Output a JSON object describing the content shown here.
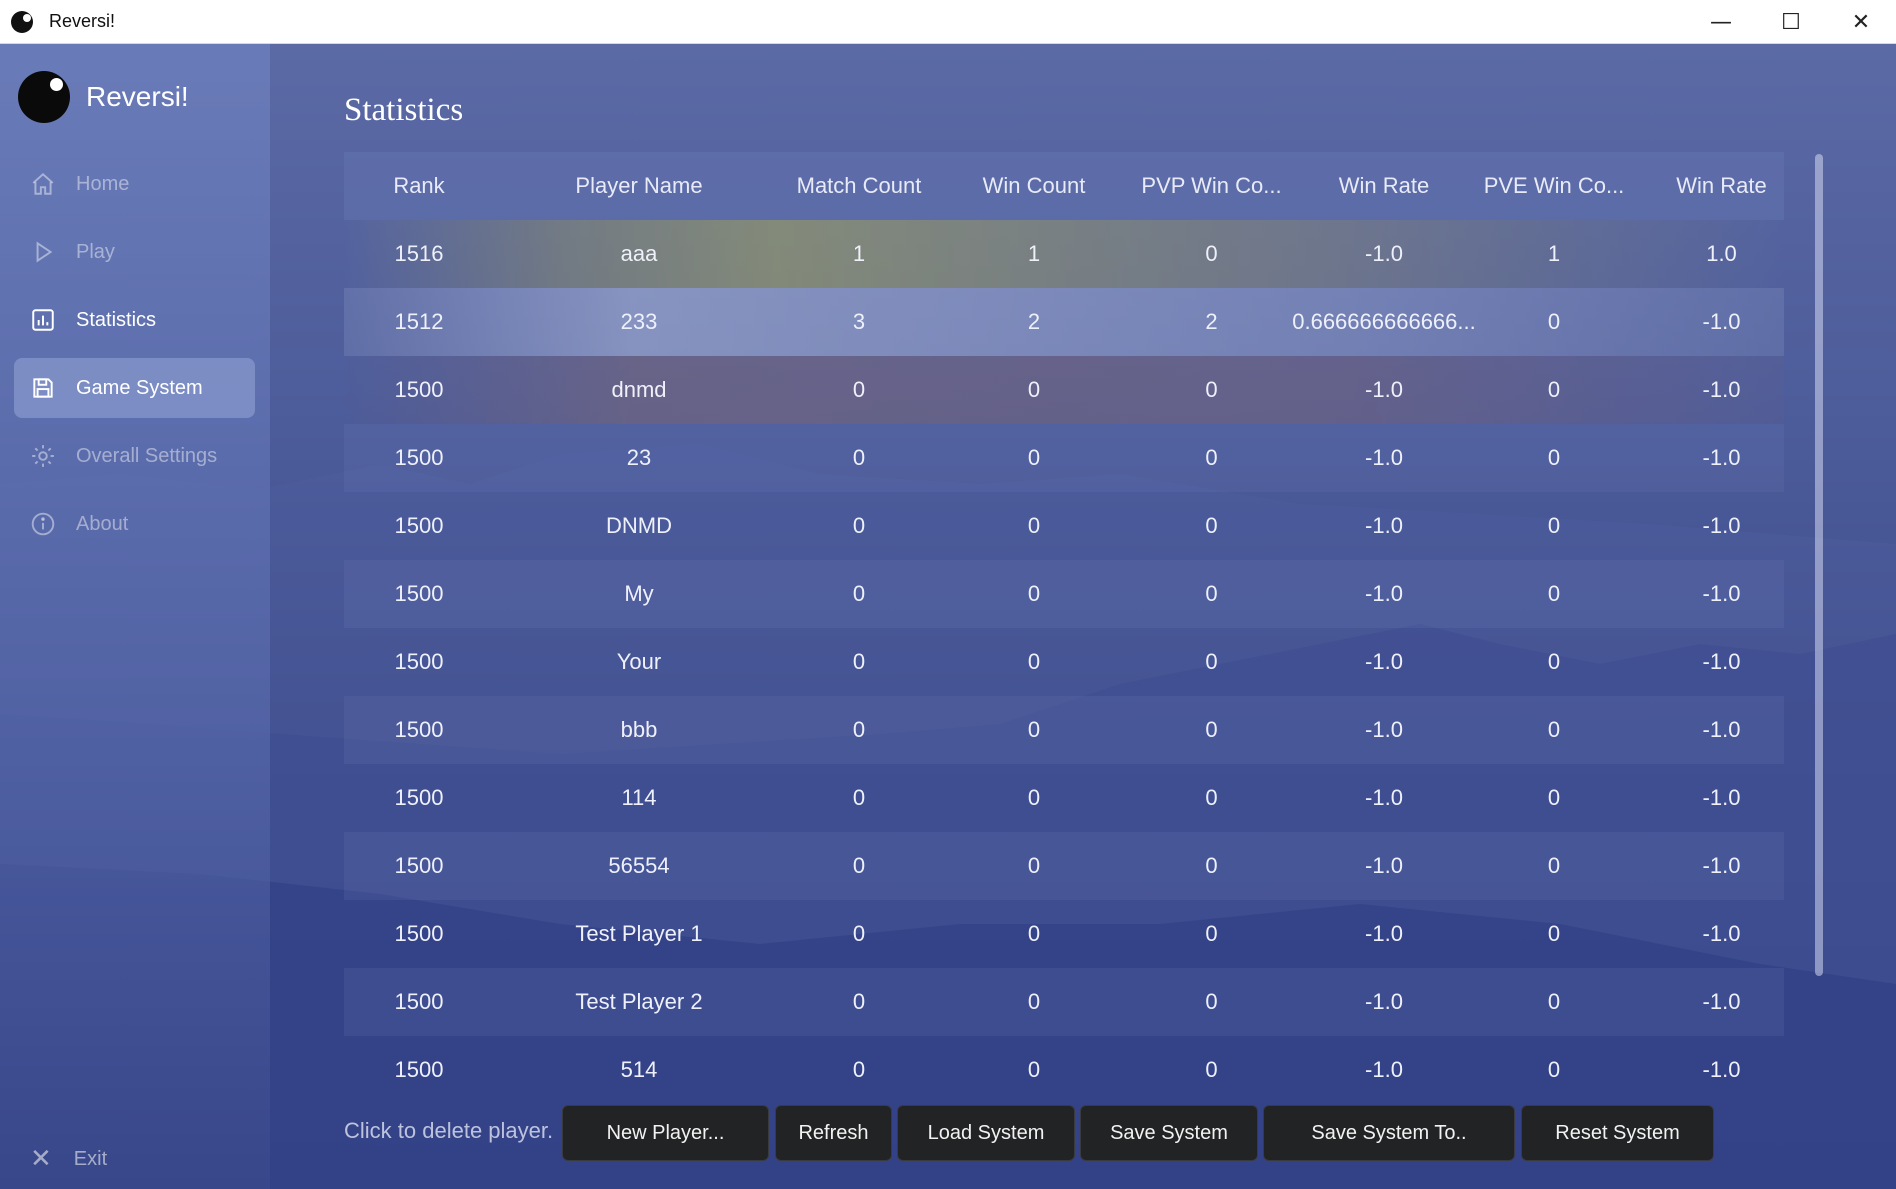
{
  "window": {
    "title": "Reversi!"
  },
  "window_controls": {
    "minimize": "—",
    "maximize": "☐",
    "close": "✕"
  },
  "sidebar": {
    "brand": "Reversi!",
    "items": [
      {
        "label": "Home",
        "icon": "home-icon"
      },
      {
        "label": "Play",
        "icon": "play-icon"
      },
      {
        "label": "Statistics",
        "icon": "chart-icon"
      },
      {
        "label": "Game System",
        "icon": "save-icon"
      },
      {
        "label": "Overall Settings",
        "icon": "gear-icon"
      },
      {
        "label": "About",
        "icon": "info-icon"
      }
    ],
    "selected": "Game System",
    "exit": {
      "label": "Exit",
      "icon": "close-icon"
    }
  },
  "page": {
    "title": "Statistics"
  },
  "table": {
    "headers": [
      "Rank",
      "Player Name",
      "Match Count",
      "Win Count",
      "PVP Win Co...",
      "Win Rate",
      "PVE Win Co...",
      "Win Rate"
    ],
    "rows": [
      [
        "1516",
        "aaa",
        "1",
        "1",
        "0",
        "-1.0",
        "1",
        "1.0"
      ],
      [
        "1512",
        "233",
        "3",
        "2",
        "2",
        "0.666666666666...",
        "0",
        "-1.0"
      ],
      [
        "1500",
        "dnmd",
        "0",
        "0",
        "0",
        "-1.0",
        "0",
        "-1.0"
      ],
      [
        "1500",
        "23",
        "0",
        "0",
        "0",
        "-1.0",
        "0",
        "-1.0"
      ],
      [
        "1500",
        "DNMD",
        "0",
        "0",
        "0",
        "-1.0",
        "0",
        "-1.0"
      ],
      [
        "1500",
        "My",
        "0",
        "0",
        "0",
        "-1.0",
        "0",
        "-1.0"
      ],
      [
        "1500",
        "Your",
        "0",
        "0",
        "0",
        "-1.0",
        "0",
        "-1.0"
      ],
      [
        "1500",
        "bbb",
        "0",
        "0",
        "0",
        "-1.0",
        "0",
        "-1.0"
      ],
      [
        "1500",
        "114",
        "0",
        "0",
        "0",
        "-1.0",
        "0",
        "-1.0"
      ],
      [
        "1500",
        "56554",
        "0",
        "0",
        "0",
        "-1.0",
        "0",
        "-1.0"
      ],
      [
        "1500",
        "Test Player 1",
        "0",
        "0",
        "0",
        "-1.0",
        "0",
        "-1.0"
      ],
      [
        "1500",
        "Test Player 2",
        "0",
        "0",
        "0",
        "-1.0",
        "0",
        "-1.0"
      ],
      [
        "1500",
        "514",
        "0",
        "0",
        "0",
        "-1.0",
        "0",
        "-1.0"
      ]
    ]
  },
  "footer": {
    "hint": "Click to delete player.",
    "buttons": [
      "New Player...",
      "Refresh",
      "Load System",
      "Save System",
      "Save System To..",
      "Reset System"
    ]
  },
  "colors": {
    "button_bg": "#222324",
    "sidebar_active": "#96a5d7"
  }
}
